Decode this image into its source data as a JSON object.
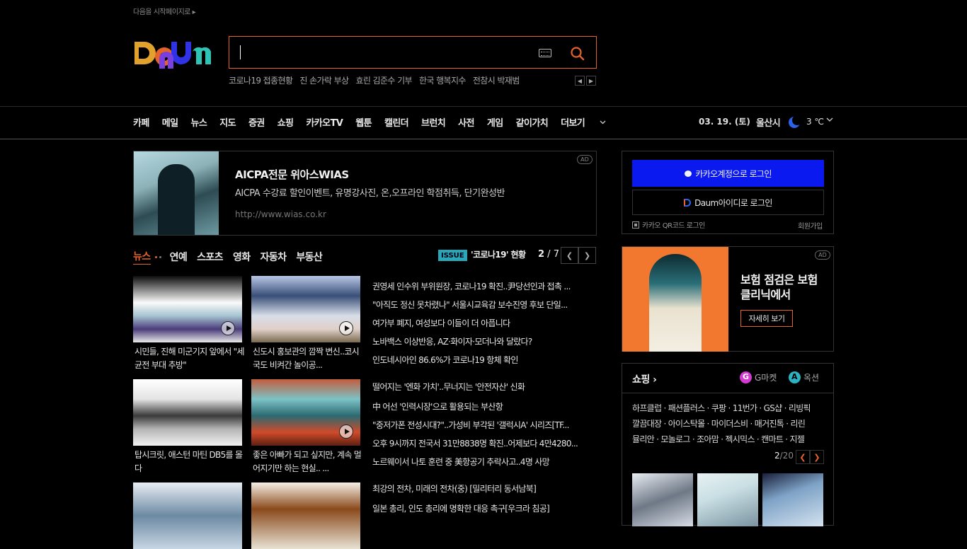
{
  "top": {
    "startpage": "다음을 시작페이지로 ▸"
  },
  "logo": {
    "alt": "Daum"
  },
  "search": {
    "value": "",
    "keywords": [
      "코로나19 접종현황",
      "진 손가락 부상",
      "효린 김준수 기부",
      "한국 행복지수",
      "전참시 박재범"
    ]
  },
  "nav": {
    "items": [
      "카페",
      "메일",
      "뉴스",
      "지도",
      "증권",
      "쇼핑",
      "카카오TV",
      "웹툰",
      "캘린더",
      "브런치",
      "사전",
      "게임",
      "같이가치"
    ],
    "more": "더보기"
  },
  "weather": {
    "date": "03. 19. (토)",
    "city": "울산시",
    "temp": "3 ℃"
  },
  "ad": {
    "tag": "AD",
    "title": "AICPA전문 위아스WIAS",
    "desc": "AICPA 수강료 할인이벤트, 유명강사진, 온,오프라인 학점취득, 단기완성반",
    "url": "http://www.wias.co.kr"
  },
  "news": {
    "tabs": [
      "뉴스",
      "연예",
      "스포츠",
      "영화",
      "자동차",
      "부동산"
    ],
    "issue_badge": "ISSUE",
    "issue_text": "'코로나19' 현황",
    "page_current": "2",
    "page_total": " / 7",
    "thumbs": [
      {
        "caption": "시민들, 진해 미군기지 앞에서 \"세균전 부대 추방\""
      },
      {
        "caption": "신도시 홍보관의 깜짝 변신..코시국도 비켜간 놀이공..."
      },
      {
        "caption": "탑시크릿, 애스턴 마틴 DB5를 몰다"
      },
      {
        "caption": "좋은 아빠가 되고 싶지만, 계속 멀어지기만 하는 현실.. ..."
      }
    ],
    "headlines_group1": [
      "권영세 인수위 부위원장, 코로나19 확진..尹당선인과 접촉 ...",
      "\"아직도 정신 못차렸나\" 서울시교육감 보수진영 후보 단일...",
      "여가부 폐지, 여성보다 이들이 더 아픕니다",
      "노바백스 이상반응, AZ·화이자·모더나와 달랐다?",
      "인도네시아인 86.6%가 코로나19 항체 확인"
    ],
    "headlines_group2": [
      "떨어지는 '엔화 가치'..무너지는 '안전자산' 신화",
      "中 어선 '인력시장'으로 활용되는 부산항",
      "\"중저가폰 전성시대?\"..가성비 부각된 '갤럭시A' 시리즈[TF...",
      "오후 9시까지 전국서 31만8838명 확진..어제보다 4만4280...",
      "노르웨이서 나토 훈련 중 美항공기 추락사고..4명 사망"
    ],
    "headlines_group3": [
      "최강의 전차, 미래의 전차(중) [밀리터리 동서남북]",
      "일본 총리, 인도 총리에 명확한 대응 촉구[우크라 침공]"
    ]
  },
  "login": {
    "kakao": "카카오계정으로 로그인",
    "daum": "Daum아이디로 로그인",
    "qr": "카카오 QR코드 로그인",
    "join": "회원가입"
  },
  "ad2": {
    "tag": "AD",
    "title": "보험 점검은 보험클리닉에서",
    "button": "자세히 보기"
  },
  "shopping": {
    "title": "쇼핑",
    "gmarket": "G마켓",
    "auction": "옥션",
    "lines": [
      "하프클럽 · 패션플러스 · 쿠팡 · 11번가 · GS샵 · 리빙픽",
      "깔끔대장 · 아이스탁몰 · 마이더스비 · 매거진톡 · 리린",
      "뮬리안 · 모놀로그 · 조아맘 · 젝시믹스 · 캔마트 · 지젤"
    ],
    "page_current": "2",
    "page_total": "/20"
  },
  "colors": {
    "accent": "#e5622b",
    "kakao_blue": "#0a19f0",
    "issue": "#2aa6b9"
  }
}
